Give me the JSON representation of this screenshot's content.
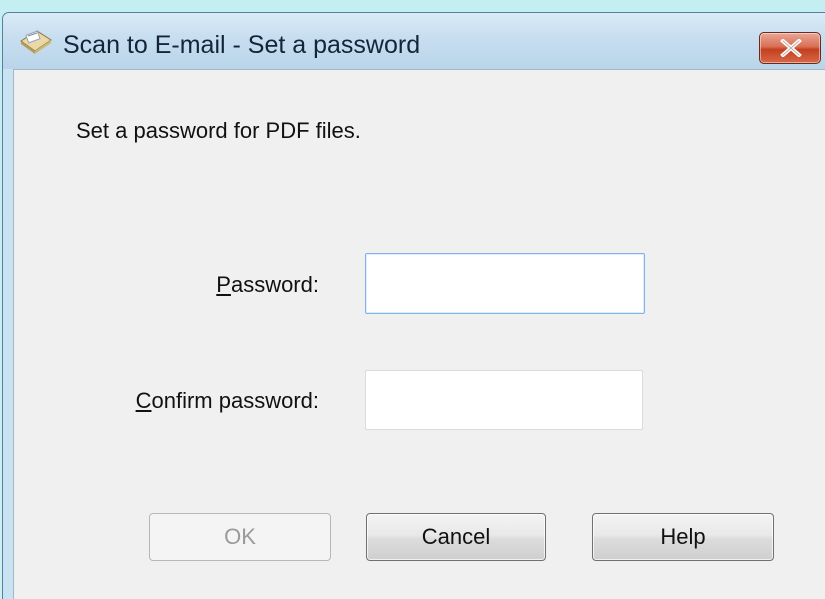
{
  "window": {
    "title": "Scan to E-mail - Set a password",
    "app_icon": "scanner-envelope-icon",
    "close_icon": "close-icon",
    "accent_close_color": "#c9452a"
  },
  "dialog": {
    "instruction": "Set a password for PDF files.",
    "password": {
      "label_accel": "P",
      "label_rest": "assword:",
      "value": "",
      "placeholder": ""
    },
    "confirm_password": {
      "label_accel": "C",
      "label_rest": "onfirm password:",
      "value": "",
      "placeholder": ""
    },
    "buttons": {
      "ok": "OK",
      "cancel": "Cancel",
      "help": "Help"
    },
    "ok_enabled": false
  }
}
